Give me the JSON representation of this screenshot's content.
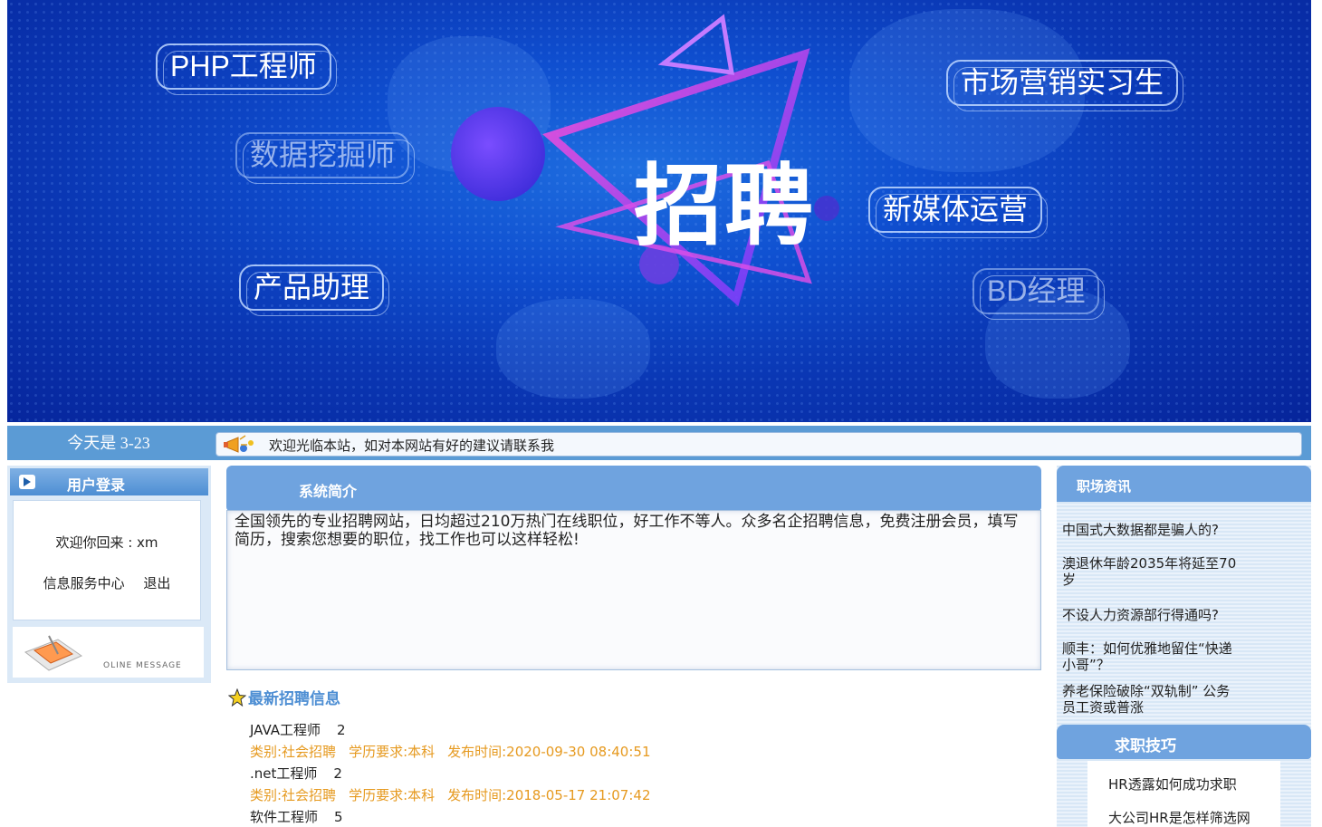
{
  "banner": {
    "title": "招聘",
    "tags": [
      "PHP工程师",
      "数据挖掘师",
      "产品助理",
      "市场营销实习生",
      "新媒体运营",
      "BD经理"
    ]
  },
  "infobar": {
    "date": "今天是 3-23",
    "notice": "欢迎光临本站，如对本网站有好的建议请联系我"
  },
  "login": {
    "title": "用户登录",
    "welcome": "欢迎你回来 : xm",
    "service_center": "信息服务中心",
    "logout": "退出",
    "message_caption": "OLINE MESSAGE"
  },
  "intro": {
    "title": "系统简介",
    "text": "全国领先的专业招聘网站，日均超过210万热门在线职位，好工作不等人。众多名企招聘信息，免费注册会员，填写简历，搜索您想要的职位，找工作也可以这样轻松!"
  },
  "jobs": {
    "title": "最新招聘信息",
    "items": [
      {
        "name": "JAVA工程师",
        "count": "2",
        "category": "类别:社会招聘",
        "education": "学历要求:本科",
        "time": "发布时间:2020-09-30 08:40:51"
      },
      {
        "name": ".net工程师",
        "count": "2",
        "category": "类别:社会招聘",
        "education": "学历要求:本科",
        "time": "发布时间:2018-05-17 21:07:42"
      },
      {
        "name": "软件工程师",
        "count": "5"
      }
    ]
  },
  "news": {
    "title": "职场资讯",
    "items": [
      "中国式大数据都是骗人的?",
      "澳退休年龄2035年将延至70岁",
      "不设人力资源部行得通吗?",
      "顺丰：如何优雅地留住“快递小哥”？",
      "养老保险破除“双轨制” 公务员工资或普涨"
    ]
  },
  "tips": {
    "title": "求职技巧",
    "items": [
      "HR透露如何成功求职",
      "大公司HR是怎样筛选网"
    ]
  },
  "colors": {
    "header_blue": "#6fa3df",
    "accent_orange": "#e69a20",
    "banner_blue": "#0a37b4"
  }
}
